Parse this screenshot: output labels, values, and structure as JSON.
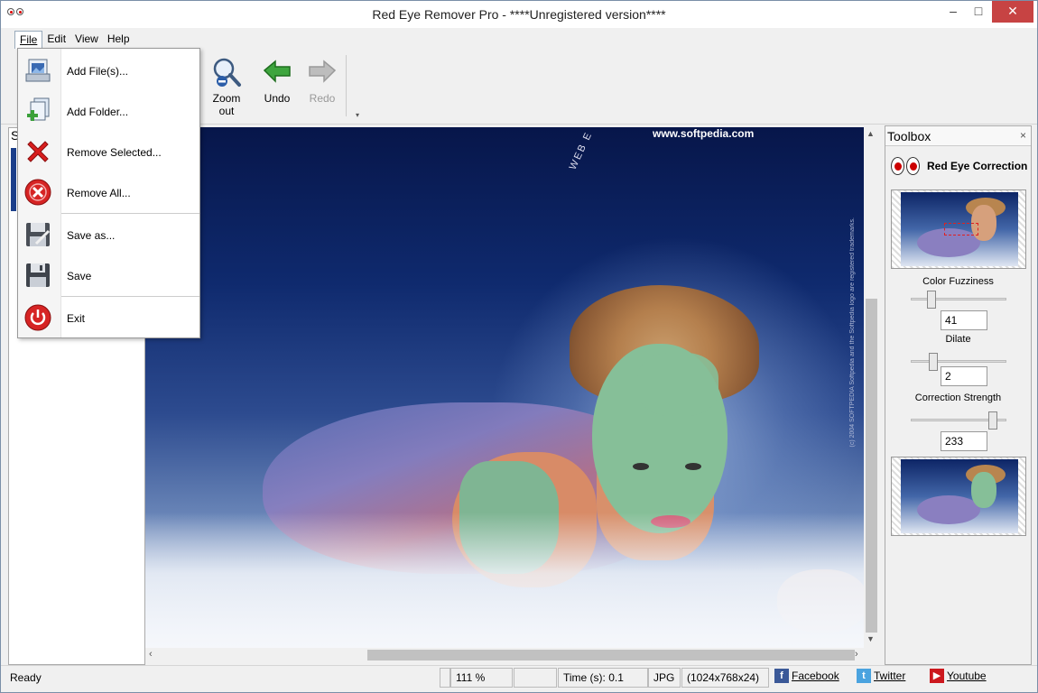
{
  "window": {
    "title": "Red Eye Remover Pro - ****Unregistered version****",
    "minimize": "–",
    "maximize": "□",
    "close": "✕"
  },
  "menubar": {
    "items": [
      {
        "label": "File"
      },
      {
        "label": "Edit"
      },
      {
        "label": "View"
      },
      {
        "label": "Help"
      }
    ]
  },
  "toolbar": {
    "zoom_out_line1": "Zoom",
    "zoom_out_line2": "out",
    "undo": "Undo",
    "redo": "Redo",
    "overflow": "▾"
  },
  "file_menu": {
    "items": [
      {
        "label": "Add File(s)...",
        "icon": "add-files-icon"
      },
      {
        "label": "Add Folder...",
        "icon": "add-folder-icon"
      },
      {
        "label": "Remove Selected...",
        "icon": "remove-selected-icon"
      },
      {
        "label": "Remove All...",
        "icon": "remove-all-icon"
      },
      {
        "label": "Save as...",
        "icon": "save-as-icon"
      },
      {
        "label": "Save",
        "icon": "save-icon"
      },
      {
        "label": "Exit",
        "icon": "exit-icon"
      }
    ]
  },
  "left_panel": {
    "header": "S"
  },
  "image": {
    "watermark": "www.softpedia.com",
    "web_text": "WEB E",
    "vertical_note": "(c) 2004 SOFTPEDIA  Softpedia and the Softpedia logo are registered trademarks."
  },
  "toolbox": {
    "title": "Toolbox",
    "close": "×",
    "tool_name": "Red Eye Correction",
    "color_fuzziness_label": "Color Fuzziness",
    "color_fuzziness_value": "41",
    "dilate_label": "Dilate",
    "dilate_value": "2",
    "correction_strength_label": "Correction Strength",
    "correction_strength_value": "233"
  },
  "statusbar": {
    "ready": "Ready",
    "zoom": "111 %",
    "time": "Time (s): 0.1",
    "format": "JPG",
    "dimensions": "(1024x768x24)",
    "facebook": "Facebook",
    "twitter": "Twitter",
    "youtube": "Youtube"
  },
  "colors": {
    "close_button": "#c74343",
    "red_eye": "#cc0000"
  }
}
